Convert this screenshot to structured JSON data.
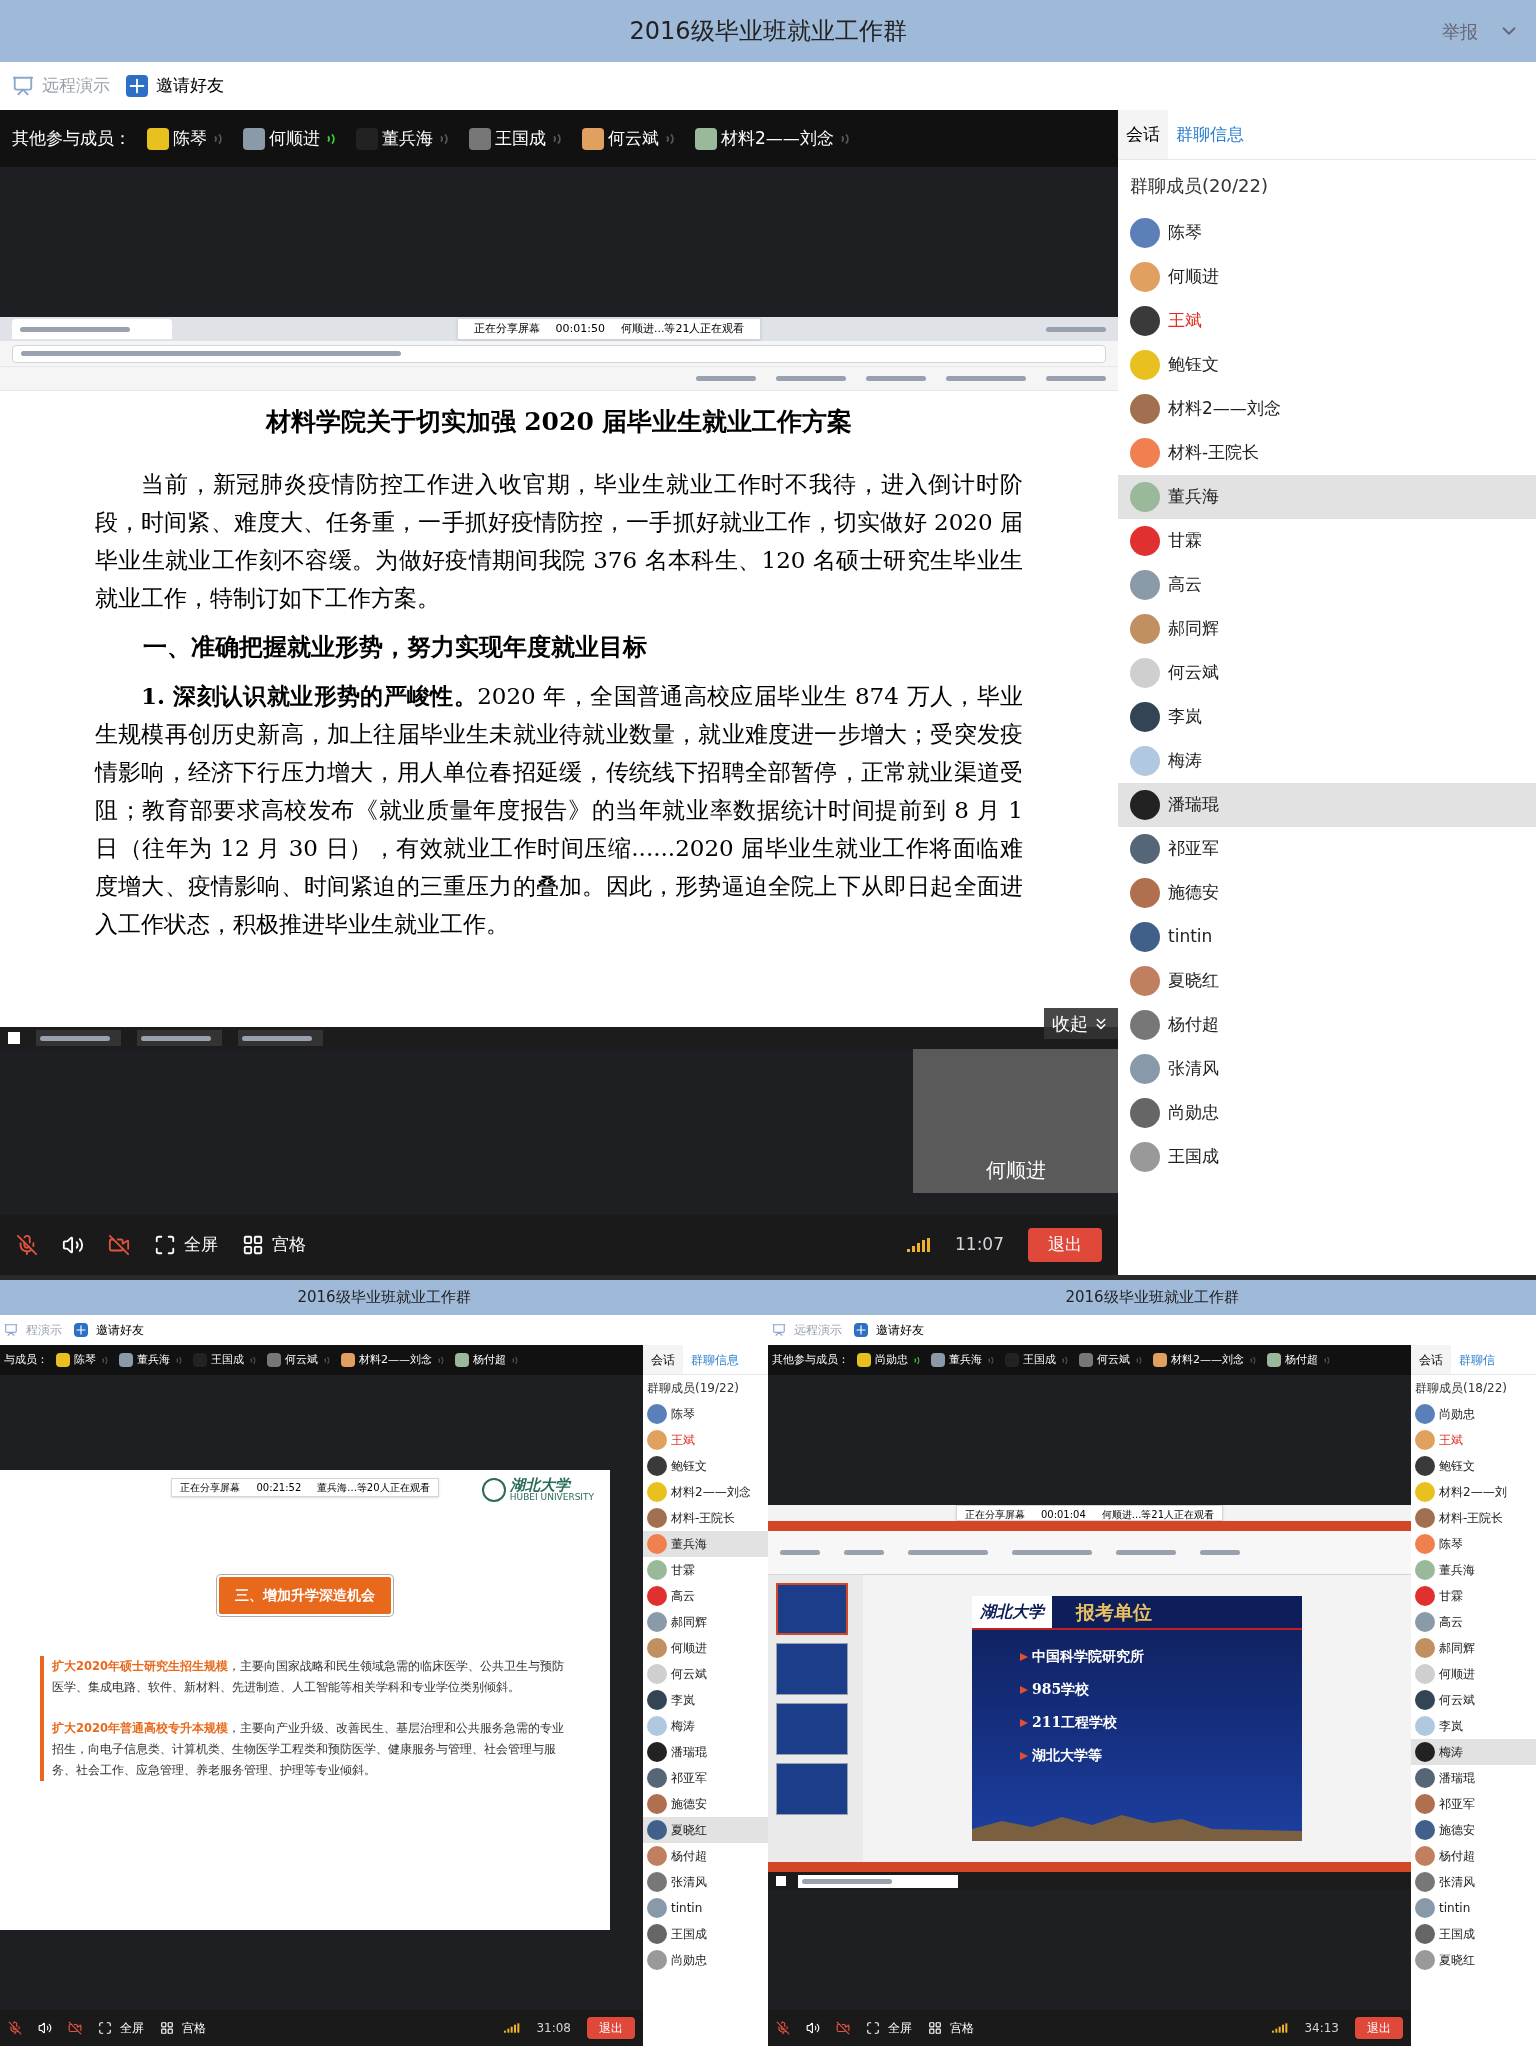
{
  "windows": [
    {
      "title": "2016级毕业班就业工作群",
      "report": "举报",
      "toolbar": [
        {
          "label": "远程演示",
          "disabled": true
        },
        {
          "label": "邀请好友",
          "disabled": false
        }
      ],
      "participants_label": "其他参与成员：",
      "participants": [
        {
          "name": "陈琴",
          "speaking": false
        },
        {
          "name": "何顺进",
          "speaking": true
        },
        {
          "name": "董兵海",
          "speaking": false
        },
        {
          "name": "王国成",
          "speaking": false
        },
        {
          "name": "何云斌",
          "speaking": false
        },
        {
          "name": "材料2——刘念",
          "speaking": false
        }
      ],
      "tabs": [
        {
          "label": "会话",
          "selected": false
        },
        {
          "label": "群聊信息",
          "selected": true
        }
      ],
      "members_heading": "群聊成员(20/22)",
      "members": [
        {
          "name": "陈琴",
          "owner": false,
          "selected": false
        },
        {
          "name": "何顺进",
          "owner": false,
          "selected": false
        },
        {
          "name": "王斌",
          "owner": true,
          "selected": false
        },
        {
          "name": "鲍钰文",
          "owner": false,
          "selected": false
        },
        {
          "name": "材料2——刘念",
          "owner": false,
          "selected": false
        },
        {
          "name": "材料-王院长",
          "owner": false,
          "selected": false
        },
        {
          "name": "董兵海",
          "owner": false,
          "selected": true
        },
        {
          "name": "甘霖",
          "owner": false,
          "selected": false
        },
        {
          "name": "高云",
          "owner": false,
          "selected": false
        },
        {
          "name": "郝同辉",
          "owner": false,
          "selected": false
        },
        {
          "name": "何云斌",
          "owner": false,
          "selected": false
        },
        {
          "name": "李岚",
          "owner": false,
          "selected": false
        },
        {
          "name": "梅涛",
          "owner": false,
          "selected": false
        },
        {
          "name": "潘瑞琨",
          "owner": false,
          "selected": true
        },
        {
          "name": "祁亚军",
          "owner": false,
          "selected": false
        },
        {
          "name": "施德安",
          "owner": false,
          "selected": false
        },
        {
          "name": "tintin",
          "owner": false,
          "selected": false
        },
        {
          "name": "夏晓红",
          "owner": false,
          "selected": false
        },
        {
          "name": "杨付超",
          "owner": false,
          "selected": false
        },
        {
          "name": "张清风",
          "owner": false,
          "selected": false
        },
        {
          "name": "尚勋忠",
          "owner": false,
          "selected": false
        },
        {
          "name": "王国成",
          "owner": false,
          "selected": false
        }
      ],
      "share": {
        "kind": "document",
        "banner": {
          "label": "正在分享屏幕",
          "time": "00:01:50",
          "viewers": "何顺进...等21人正在观看"
        },
        "title": "材料学院关于切实加强 2020 届毕业生就业工作方案",
        "paragraphs": [
          {
            "kind": "body",
            "text": "当前，新冠肺炎疫情防控工作进入收官期，毕业生就业工作时不我待，进入倒计时阶段，时间紧、难度大、任务重，一手抓好疫情防控，一手抓好就业工作，切实做好 2020 届毕业生就业工作刻不容缓。为做好疫情期间我院 376 名本科生、120 名硕士研究生毕业生就业工作，特制订如下工作方案。"
          },
          {
            "kind": "heading",
            "text": "一、准确把握就业形势，努力实现年度就业目标"
          },
          {
            "kind": "body",
            "text": "**1. 深刻认识就业形势的严峻性。**2020 年，全国普通高校应届毕业生 874 万人，毕业生规模再创历史新高，加上往届毕业生未就业待就业数量，就业难度进一步增大；受突发疫情影响，经济下行压力增大，用人单位春招延缓，传统线下招聘全部暂停，正常就业渠道受阻；教育部要求高校发布《就业质量年度报告》的当年就业率数据统计时间提前到 8 月 1 日（往年为 12 月 30 日），有效就业工作时间压缩......2020 届毕业生就业工作将面临难度增大、疫情影响、时间紧迫的三重压力的叠加。因此，形势逼迫全院上下从即日起全面进入工作状态，积极推进毕业生就业工作。"
          }
        ],
        "collapse": "收起",
        "video_label": "何顺进"
      },
      "controls": {
        "fullscreen": "全屏",
        "grid": "宫格",
        "time": "11:07",
        "exit": "退出"
      }
    },
    {
      "title": "2016级毕业班就业工作群",
      "toolbar": [
        {
          "label": "程演示",
          "disabled": true
        },
        {
          "label": "邀请好友",
          "disabled": false
        }
      ],
      "participants_label": "与成员：",
      "participants": [
        {
          "name": "陈琴",
          "speaking": false
        },
        {
          "name": "董兵海",
          "speaking": false
        },
        {
          "name": "王国成",
          "speaking": false
        },
        {
          "name": "何云斌",
          "speaking": false
        },
        {
          "name": "材料2——刘念",
          "speaking": false
        },
        {
          "name": "杨付超",
          "speaking": false
        }
      ],
      "tabs": [
        {
          "label": "会话",
          "selected": false
        },
        {
          "label": "群聊信息",
          "selected": true
        }
      ],
      "members_heading": "群聊成员(19/22)",
      "members": [
        {
          "name": "陈琴",
          "owner": false,
          "selected": false
        },
        {
          "name": "王斌",
          "owner": true,
          "selected": false
        },
        {
          "name": "鲍钰文",
          "owner": false,
          "selected": false
        },
        {
          "name": "材料2——刘念",
          "owner": false,
          "selected": false
        },
        {
          "name": "材料-王院长",
          "owner": false,
          "selected": false
        },
        {
          "name": "董兵海",
          "owner": false,
          "selected": true
        },
        {
          "name": "甘霖",
          "owner": false,
          "selected": false
        },
        {
          "name": "高云",
          "owner": false,
          "selected": false
        },
        {
          "name": "郝同辉",
          "owner": false,
          "selected": false
        },
        {
          "name": "何顺进",
          "owner": false,
          "selected": false
        },
        {
          "name": "何云斌",
          "owner": false,
          "selected": false
        },
        {
          "name": "李岚",
          "owner": false,
          "selected": false
        },
        {
          "name": "梅涛",
          "owner": false,
          "selected": false
        },
        {
          "name": "潘瑞琨",
          "owner": false,
          "selected": false
        },
        {
          "name": "祁亚军",
          "owner": false,
          "selected": false
        },
        {
          "name": "施德安",
          "owner": false,
          "selected": false
        },
        {
          "name": "夏晓红",
          "owner": false,
          "selected": true
        },
        {
          "name": "杨付超",
          "owner": false,
          "selected": false
        },
        {
          "name": "张清风",
          "owner": false,
          "selected": false
        },
        {
          "name": "tintin",
          "owner": false,
          "selected": false
        },
        {
          "name": "王国成",
          "owner": false,
          "selected": false
        },
        {
          "name": "尚勋忠",
          "owner": false,
          "selected": false
        }
      ],
      "share": {
        "kind": "slide",
        "banner": {
          "label": "正在分享屏幕",
          "time": "00:21:52",
          "viewers": "董兵海...等20人正在观看"
        },
        "logo": "湖北大学",
        "logo_sub": "HUBEI UNIVERSITY",
        "heading": "三、增加升学深造机会",
        "paragraphs": [
          "**扩大2020年硕士研究生招生规模**，主要向国家战略和民生领域急需的临床医学、公共卫生与预防医学、集成电路、软件、新材料、先进制造、人工智能等相关学科和专业学位类别倾斜。",
          "**扩大2020年普通高校专升本规模**，主要向产业升级、改善民生、基层治理和公共服务急需的专业招生，向电子信息类、计算机类、生物医学工程类和预防医学、健康服务与管理、社会管理与服务、社会工作、应急管理、养老服务管理、护理等专业倾斜。"
        ]
      },
      "controls": {
        "fullscreen": "全屏",
        "grid": "宫格",
        "time": "31:08",
        "exit": "退出"
      }
    },
    {
      "title": "2016级毕业班就业工作群",
      "toolbar": [
        {
          "label": "远程演示",
          "disabled": true
        },
        {
          "label": "邀请好友",
          "disabled": false
        }
      ],
      "participants_label": "其他参与成员：",
      "participants": [
        {
          "name": "尚勋忠",
          "speaking": true
        },
        {
          "name": "董兵海",
          "speaking": false
        },
        {
          "name": "王国成",
          "speaking": false
        },
        {
          "name": "何云斌",
          "speaking": false
        },
        {
          "name": "材料2——刘念",
          "speaking": false
        },
        {
          "name": "杨付超",
          "speaking": false
        }
      ],
      "tabs": [
        {
          "label": "会话",
          "selected": false
        },
        {
          "label": "群聊信",
          "selected": true
        }
      ],
      "members_heading": "群聊成员(18/22)",
      "members": [
        {
          "name": "尚勋忠",
          "owner": false,
          "selected": false
        },
        {
          "name": "王斌",
          "owner": true,
          "selected": false
        },
        {
          "name": "鲍钰文",
          "owner": false,
          "selected": false
        },
        {
          "name": "材料2——刘",
          "owner": false,
          "selected": false
        },
        {
          "name": "材料-王院长",
          "owner": false,
          "selected": false
        },
        {
          "name": "陈琴",
          "owner": false,
          "selected": false
        },
        {
          "name": "董兵海",
          "owner": false,
          "selected": false
        },
        {
          "name": "甘霖",
          "owner": false,
          "selected": false
        },
        {
          "name": "高云",
          "owner": false,
          "selected": false
        },
        {
          "name": "郝同辉",
          "owner": false,
          "selected": false
        },
        {
          "name": "何顺进",
          "owner": false,
          "selected": false
        },
        {
          "name": "何云斌",
          "owner": false,
          "selected": false
        },
        {
          "name": "李岚",
          "owner": false,
          "selected": false
        },
        {
          "name": "梅涛",
          "owner": false,
          "selected": true
        },
        {
          "name": "潘瑞琨",
          "owner": false,
          "selected": false
        },
        {
          "name": "祁亚军",
          "owner": false,
          "selected": false
        },
        {
          "name": "施德安",
          "owner": false,
          "selected": false
        },
        {
          "name": "杨付超",
          "owner": false,
          "selected": false
        },
        {
          "name": "张清风",
          "owner": false,
          "selected": false
        },
        {
          "name": "tintin",
          "owner": false,
          "selected": false
        },
        {
          "name": "王国成",
          "owner": false,
          "selected": false
        },
        {
          "name": "夏晓红",
          "owner": false,
          "selected": false
        }
      ],
      "share": {
        "kind": "powerpoint",
        "banner": {
          "label": "正在分享屏幕",
          "time": "00:01:04",
          "viewers": "何顺进...等21人正在观看"
        },
        "logo": "湖北大学",
        "title": "报考单位",
        "bullets": [
          "中国科学院研究所",
          "985学校",
          "211工程学校",
          "湖北大学等"
        ]
      },
      "controls": {
        "fullscreen": "全屏",
        "grid": "宫格",
        "time": "34:13",
        "exit": "退出"
      }
    }
  ]
}
